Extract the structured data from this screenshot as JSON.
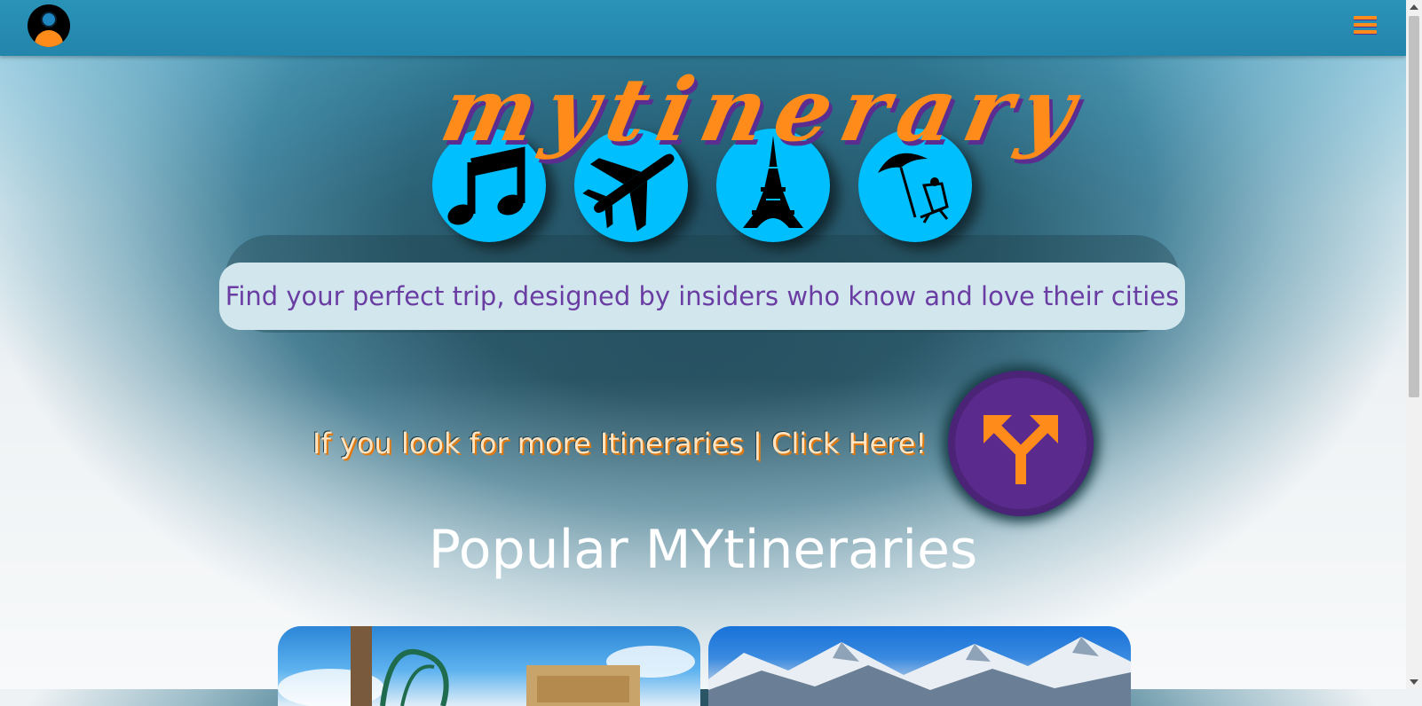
{
  "navbar": {
    "avatar_icon": "user-avatar-icon",
    "menu_icon": "hamburger-menu-icon"
  },
  "hero": {
    "brand": "mytinerary",
    "icons": [
      "music-note-icon",
      "airplane-icon",
      "eiffel-tower-icon",
      "beach-umbrella-icon"
    ],
    "tagline": "Find your perfect trip, designed by insiders who know and love their cities"
  },
  "cta": {
    "text": "If you look for more Itineraries | Click Here!",
    "button_icon": "split-arrows-icon"
  },
  "popular": {
    "title": "Popular MYtineraries",
    "cards": [
      {
        "image": "theme-park-roller-coaster-image"
      },
      {
        "image": "snowy-mountains-image"
      }
    ]
  },
  "colors": {
    "accent_orange": "#ff8c1a",
    "accent_purple": "#5c2d91",
    "icon_circle_blue": "#00bfff",
    "navbar_blue": "#2a93b8"
  }
}
